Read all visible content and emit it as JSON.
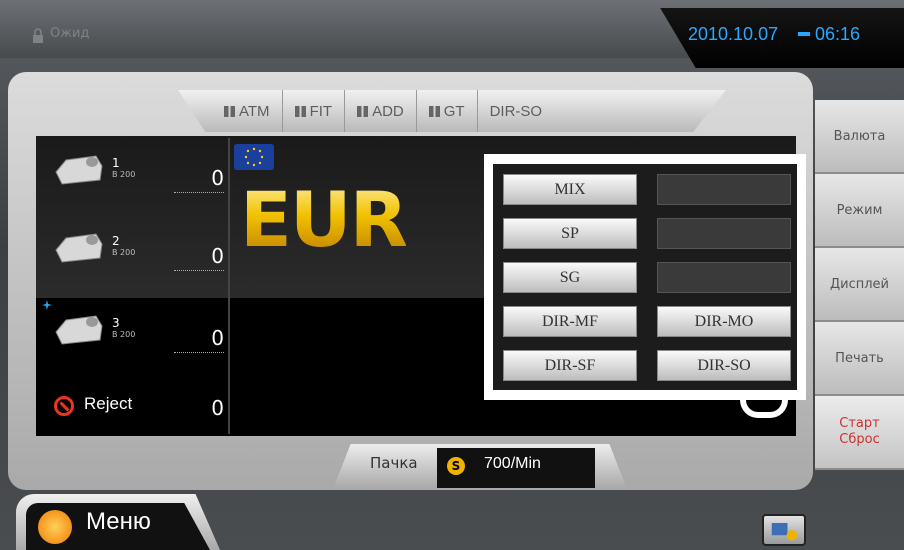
{
  "header": {
    "status_text": "Ожид",
    "date": "2010.10.07",
    "time": "06:16"
  },
  "tabs": [
    "ATM",
    "FIT",
    "ADD",
    "GT",
    "DIR-SO"
  ],
  "pockets": [
    {
      "number": "1",
      "caption": "B 200",
      "count": "0"
    },
    {
      "number": "2",
      "caption": "B 200",
      "count": "0"
    },
    {
      "number": "3",
      "caption": "B 200",
      "count": "0"
    }
  ],
  "reject": {
    "label": "Reject",
    "count": "0"
  },
  "currency": {
    "code": "EUR"
  },
  "modes": {
    "left": [
      "MIX",
      "SP",
      "SG",
      "DIR-MF",
      "DIR-SF"
    ],
    "right": [
      "",
      "",
      "",
      "DIR-MO",
      "DIR-SO"
    ]
  },
  "right_menu": [
    "Валюта",
    "Режим",
    "Дисплей",
    "Печать",
    "Старт\nСброс"
  ],
  "bottom": {
    "bundle_label": "Пачка",
    "speed_icon": "S",
    "speed": "700/Min",
    "menu_label": "Меню"
  },
  "colors": {
    "clock": "#2aa8ff",
    "currency_gold": "#f0b400",
    "reject_red": "#e32222",
    "start_red": "#d03030"
  }
}
